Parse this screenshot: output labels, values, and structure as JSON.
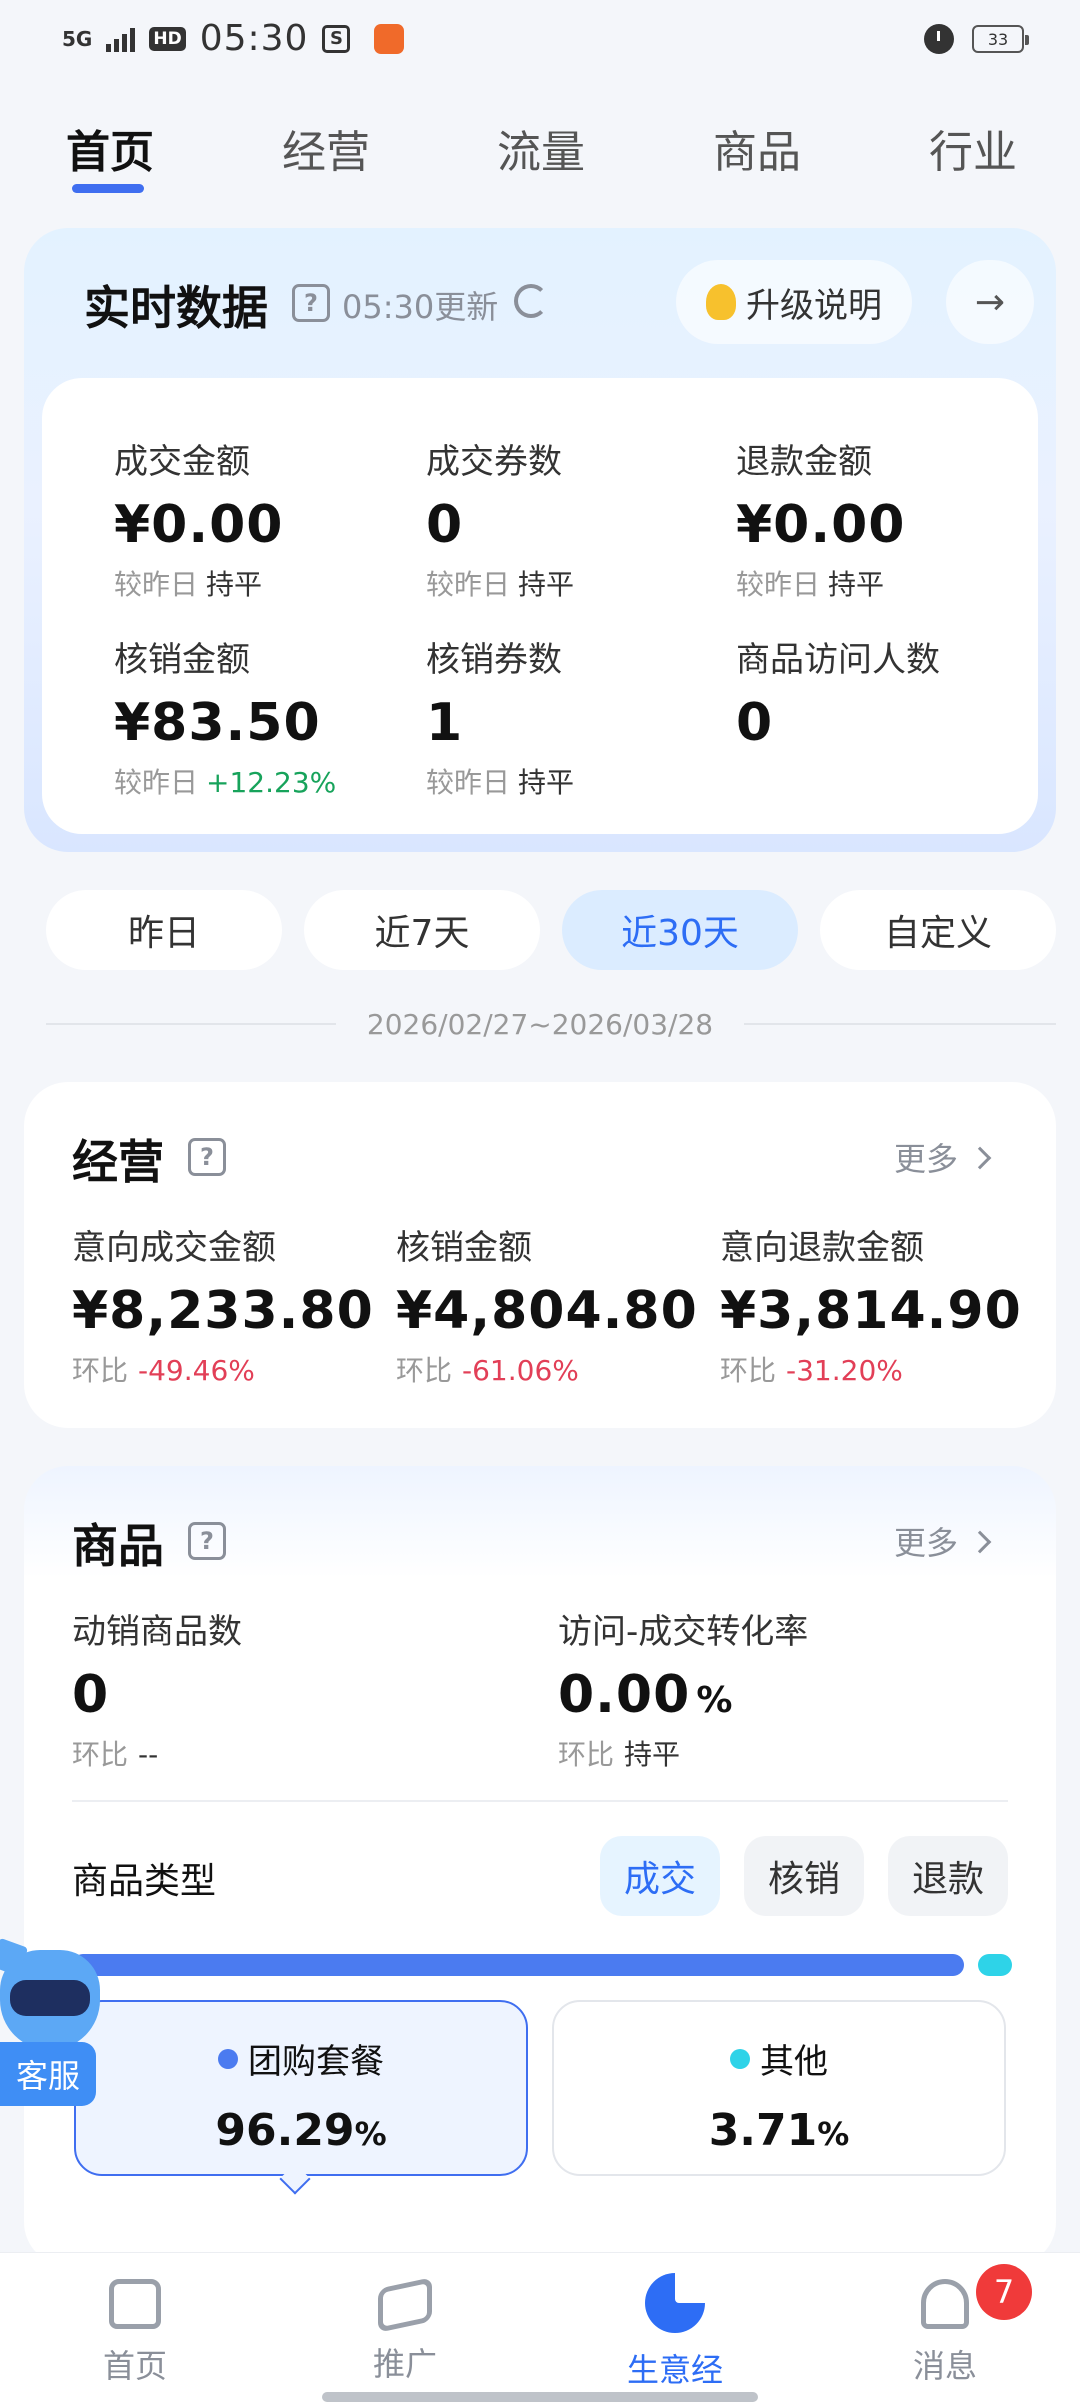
{
  "status_bar": {
    "network": "5G",
    "hd": "HD",
    "time": "05:30",
    "battery": "33"
  },
  "top_tabs": [
    "首页",
    "经营",
    "流量",
    "商品",
    "行业"
  ],
  "realtime": {
    "title": "实时数据",
    "help": "?",
    "update_text": "05:30更新",
    "upgrade_label": "升级说明",
    "arrow": "→",
    "metrics": [
      {
        "label": "成交金额",
        "value": "¥0.00",
        "cmp_label": "较昨日",
        "cmp_value": "持平"
      },
      {
        "label": "成交券数",
        "value": "0",
        "cmp_label": "较昨日",
        "cmp_value": "持平"
      },
      {
        "label": "退款金额",
        "value": "¥0.00",
        "cmp_label": "较昨日",
        "cmp_value": "持平"
      },
      {
        "label": "核销金额",
        "value": "¥83.50",
        "cmp_label": "较昨日",
        "cmp_value": "+12.23%"
      },
      {
        "label": "核销券数",
        "value": "1",
        "cmp_label": "较昨日",
        "cmp_value": "持平"
      },
      {
        "label": "商品访问人数",
        "value": "0"
      }
    ]
  },
  "date_filters": [
    "昨日",
    "近7天",
    "近30天",
    "自定义"
  ],
  "date_filter_selected": "近30天",
  "date_range": "2026/02/27~2026/03/28",
  "business": {
    "title": "经营",
    "help": "?",
    "more": "更多",
    "metrics": [
      {
        "label": "意向成交金额",
        "value": "¥8,233.80",
        "cmp_label": "环比",
        "cmp_value": "-49.46%"
      },
      {
        "label": "核销金额",
        "value": "¥4,804.80",
        "cmp_label": "环比",
        "cmp_value": "-61.06%"
      },
      {
        "label": "意向退款金额",
        "value": "¥3,814.90",
        "cmp_label": "环比",
        "cmp_value": "-31.20%"
      }
    ]
  },
  "goods": {
    "title": "商品",
    "help": "?",
    "more": "更多",
    "metrics": [
      {
        "label": "动销商品数",
        "value": "0",
        "cmp_label": "环比",
        "cmp_value": "--"
      },
      {
        "label": "访问-成交转化率",
        "value": "0.00",
        "unit": "%",
        "cmp_label": "环比",
        "cmp_value": "持平"
      }
    ],
    "type_label": "商品类型",
    "segments": [
      "成交",
      "核销",
      "退款"
    ],
    "segment_selected": "成交",
    "shares": [
      {
        "name": "团购套餐",
        "value": 96.29,
        "pct": "96.29",
        "unit": "%",
        "color": "#4b7bf0"
      },
      {
        "name": "其他",
        "value": 3.71,
        "pct": "3.71",
        "unit": "%",
        "color": "#2ed3e8"
      }
    ]
  },
  "customer_service": {
    "label": "客服"
  },
  "bottom_nav": {
    "items": [
      "首页",
      "推广",
      "生意经",
      "消息"
    ],
    "active": "生意经",
    "message_badge": "7"
  },
  "colors": {
    "accent": "#2d6df5",
    "up": "#17a35b",
    "down": "#e23f57"
  }
}
